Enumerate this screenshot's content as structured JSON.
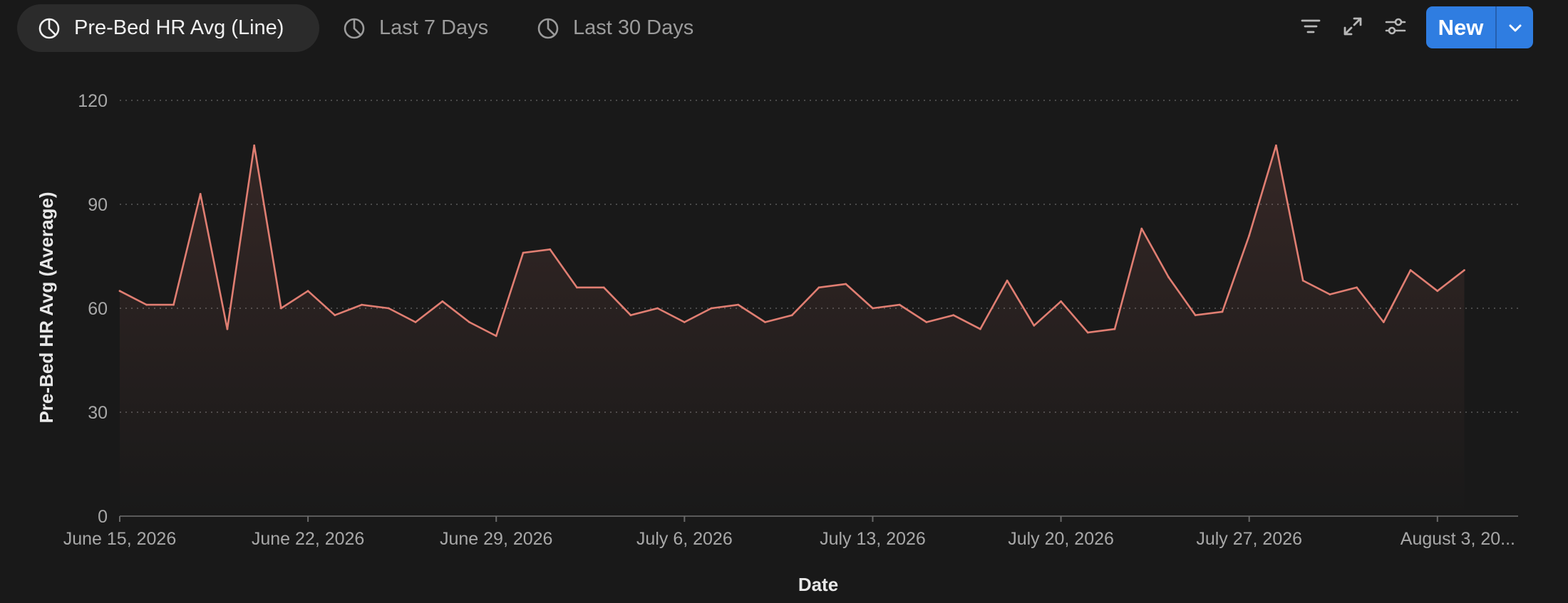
{
  "toolbar": {
    "tabs": [
      {
        "label": "Pre-Bed HR Avg (Line)",
        "icon": "pie-chart-icon",
        "active": true
      },
      {
        "label": "Last 7 Days",
        "icon": "pie-chart-icon",
        "active": false
      },
      {
        "label": "Last 30 Days",
        "icon": "pie-chart-icon",
        "active": false
      }
    ],
    "icons": [
      "filter-icon",
      "expand-icon",
      "sliders-icon"
    ],
    "new_label": "New"
  },
  "colors": {
    "background": "#191919",
    "line": "#e07e72",
    "accent": "#2f7de1",
    "grid": "#4a4a4a",
    "axis_text": "#a8a8a8"
  },
  "chart_data": {
    "type": "line",
    "x": [
      "2026-06-15",
      "2026-06-16",
      "2026-06-17",
      "2026-06-18",
      "2026-06-19",
      "2026-06-20",
      "2026-06-21",
      "2026-06-22",
      "2026-06-23",
      "2026-06-24",
      "2026-06-25",
      "2026-06-26",
      "2026-06-27",
      "2026-06-28",
      "2026-06-29",
      "2026-06-30",
      "2026-07-01",
      "2026-07-02",
      "2026-07-03",
      "2026-07-04",
      "2026-07-05",
      "2026-07-06",
      "2026-07-07",
      "2026-07-08",
      "2026-07-09",
      "2026-07-10",
      "2026-07-11",
      "2026-07-12",
      "2026-07-13",
      "2026-07-14",
      "2026-07-15",
      "2026-07-16",
      "2026-07-17",
      "2026-07-18",
      "2026-07-19",
      "2026-07-20",
      "2026-07-21",
      "2026-07-22",
      "2026-07-23",
      "2026-07-24",
      "2026-07-25",
      "2026-07-26",
      "2026-07-27",
      "2026-07-28",
      "2026-07-29",
      "2026-07-30",
      "2026-07-31",
      "2026-08-01",
      "2026-08-02",
      "2026-08-03",
      "2026-08-04",
      "2026-08-05",
      "2026-08-06"
    ],
    "series": [
      {
        "values": [
          65,
          61,
          61,
          93,
          54,
          107,
          60,
          65,
          58,
          61,
          60,
          56,
          62,
          56,
          52,
          76,
          77,
          66,
          66,
          58,
          60,
          56,
          60,
          61,
          56,
          58,
          66,
          67,
          60,
          61,
          56,
          58,
          54,
          68,
          55,
          62,
          53,
          54,
          83,
          69,
          58,
          59,
          81,
          107,
          68,
          64,
          66,
          56,
          71,
          65,
          71
        ]
      }
    ],
    "xlabel": "Date",
    "ylabel": "Pre-Bed HR Avg (Average)",
    "ylim": [
      0,
      120
    ],
    "yticks": [
      "0",
      "30",
      "60",
      "90",
      "120"
    ],
    "xticks": [
      "June 15, 2026",
      "June 22, 2026",
      "June 29, 2026",
      "July 6, 2026",
      "July 13, 2026",
      "July 20, 2026",
      "July 27, 2026",
      "August 3, 20..."
    ],
    "xtick_dates": [
      "2026-06-15",
      "2026-06-22",
      "2026-06-29",
      "2026-07-06",
      "2026-07-13",
      "2026-07-20",
      "2026-07-27",
      "2026-08-03"
    ],
    "grid": true,
    "legend": "none"
  }
}
